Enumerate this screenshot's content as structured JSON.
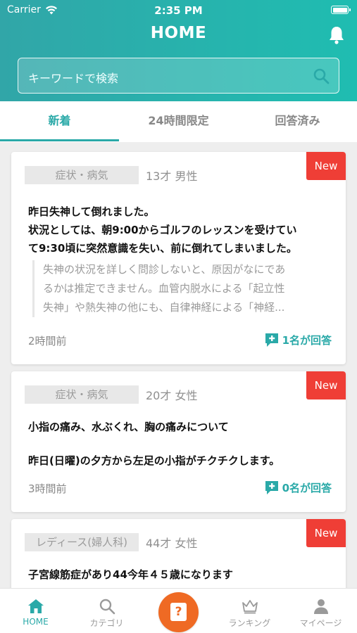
{
  "status_bar": {
    "carrier": "Carrier",
    "time": "2:35 PM"
  },
  "header": {
    "title": "HOME"
  },
  "search": {
    "placeholder": "キーワードで検索"
  },
  "tabs": [
    {
      "label": "新着",
      "active": true
    },
    {
      "label": "24時間限定",
      "active": false
    },
    {
      "label": "回答済み",
      "active": false
    }
  ],
  "questions": [
    {
      "badge": "New",
      "category": "症状・病気",
      "meta": "13才 男性",
      "title_lines": [
        "昨日失神して倒れました。",
        "状況としては、朝9:00からゴルフのレッスンを受けてい",
        "て9:30頃に突然意識を失い、前に倒れてしまいました。"
      ],
      "answer_excerpt_lines": [
        "失神の状況を詳しく問診しないと、原因がなにであ",
        "るかは推定できません。血管内脱水による「起立性",
        "失神」や熱失神の他にも、自律神経による「神経..."
      ],
      "time": "2時間前",
      "answers": "1名が回答"
    },
    {
      "badge": "New",
      "category": "症状・病気",
      "meta": "20才 女性",
      "title": "小指の痛み、水ぶくれ、胸の痛みについて",
      "body": "昨日(日曜)の夕方から左足の小指がチクチクします。",
      "time": "3時間前",
      "answers": "0名が回答"
    },
    {
      "badge": "New",
      "category": "レディース(婦人科)",
      "meta": "44才 女性",
      "title": "子宮線筋症があり44今年４５歳になります"
    }
  ],
  "tabbar": [
    {
      "label": "HOME",
      "icon": "home-icon",
      "active": true
    },
    {
      "label": "カテゴリ",
      "icon": "search-icon",
      "active": false
    },
    {
      "label": "",
      "icon": "question-icon",
      "active": false
    },
    {
      "label": "ランキング",
      "icon": "crown-icon",
      "active": false
    },
    {
      "label": "マイページ",
      "icon": "person-icon",
      "active": false
    }
  ],
  "colors": {
    "accent": "#2aa9a8",
    "badge": "#ef3e36",
    "fab": "#ef6a24"
  }
}
